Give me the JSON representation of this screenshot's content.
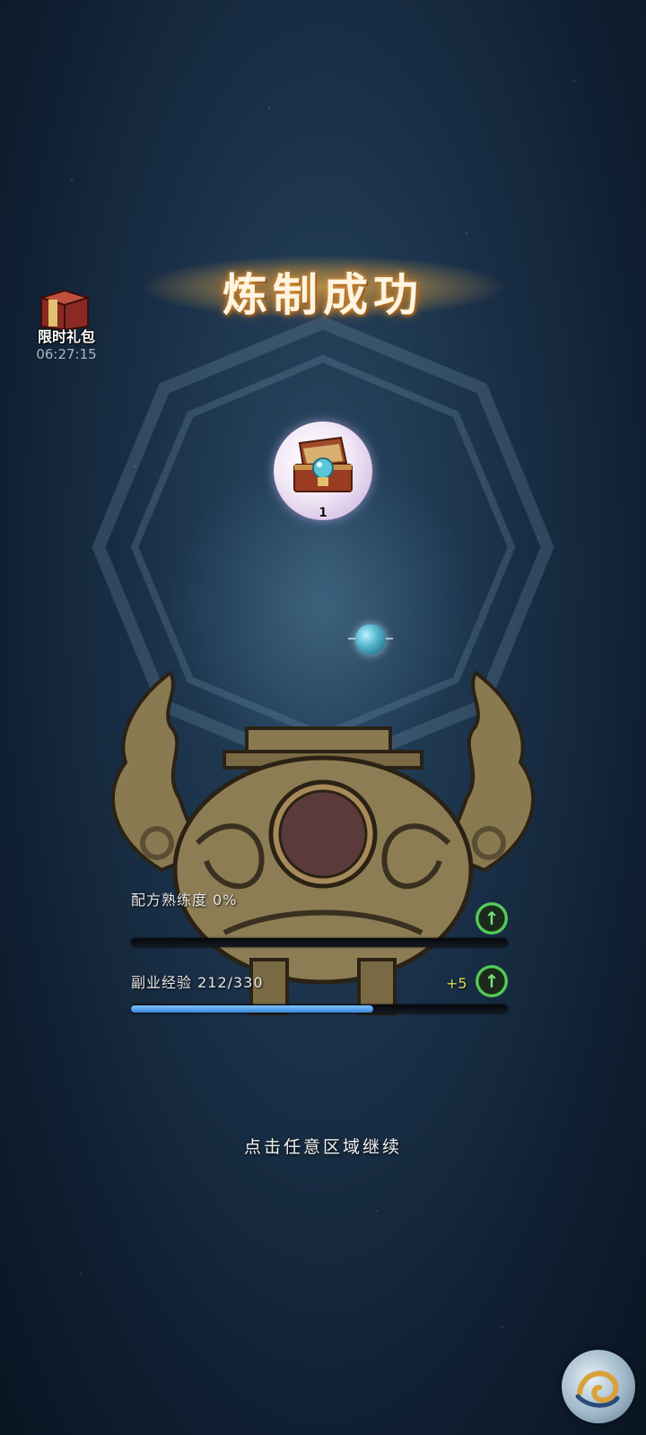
{
  "gift_pack": {
    "label": "限时礼包",
    "timer": "06:27:15",
    "icon": "gift-box-icon"
  },
  "result": {
    "title": "炼制成功"
  },
  "reward": {
    "icon": "treasure-chest-icon",
    "count": "1"
  },
  "stats": {
    "proficiency": {
      "label": "配方熟练度",
      "value": "0%",
      "icon": "level-up-arrow-icon"
    },
    "side_exp": {
      "label": "副业经验",
      "value": "212/330",
      "bonus": "+5",
      "current": 212,
      "max": 330,
      "icon": "level-up-arrow-icon"
    }
  },
  "hint": "点击任意区域继续",
  "corner_button": {
    "icon": "swirl-emblem-icon"
  },
  "colors": {
    "exp_bar": "#3a86d8",
    "up_button": "#59d45e",
    "bonus_text": "#d8dc5a"
  }
}
